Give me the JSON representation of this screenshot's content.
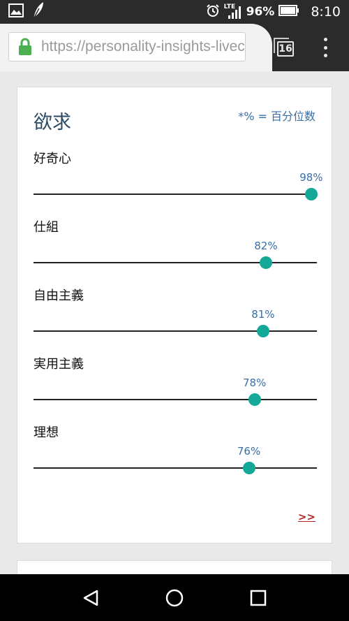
{
  "status_bar": {
    "network": "LTE",
    "battery": "96%",
    "time": "8:10"
  },
  "browser": {
    "url": "https://personality-insights-livec",
    "tab_count": "16"
  },
  "card": {
    "title": "欲求",
    "note": "*% = 百分位数",
    "more_link": ">>",
    "accent_color": "#14a899",
    "metrics": [
      {
        "label": "好奇心",
        "value": 98,
        "display": "98%"
      },
      {
        "label": "仕組",
        "value": 82,
        "display": "82%"
      },
      {
        "label": "自由主義",
        "value": 81,
        "display": "81%"
      },
      {
        "label": "実用主義",
        "value": 78,
        "display": "78%"
      },
      {
        "label": "理想",
        "value": 76,
        "display": "76%"
      }
    ]
  },
  "icons": {
    "status_left": [
      "gallery-icon",
      "feather-icon"
    ],
    "status_right": [
      "alarm-icon",
      "signal-icon",
      "battery-icon"
    ],
    "nav": [
      "back-icon",
      "home-icon",
      "recents-icon"
    ]
  }
}
